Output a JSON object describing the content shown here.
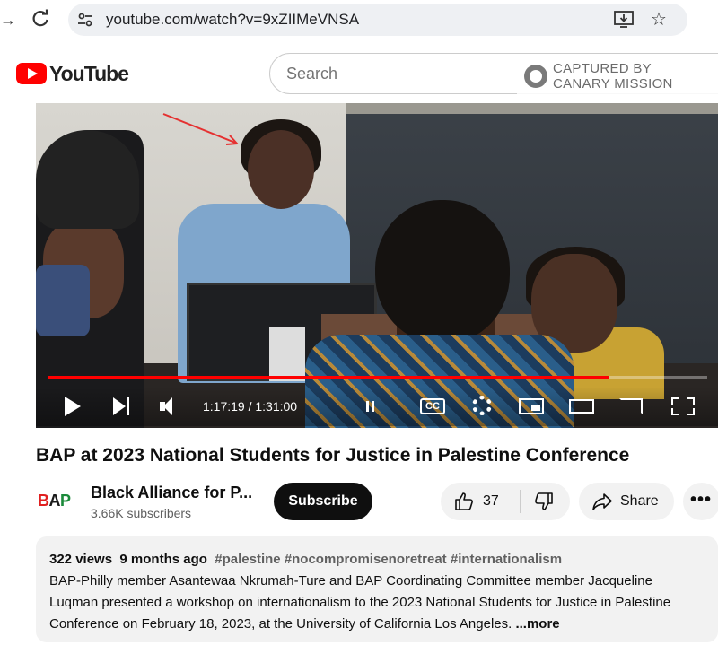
{
  "browser": {
    "url": "youtube.com/watch?v=9xZIIMeVNSA"
  },
  "header": {
    "logo_text": "YouTube",
    "search_placeholder": "Search",
    "watermark_line1": "CAPTURED BY",
    "watermark_line2": "CANARY MISSION"
  },
  "player": {
    "time_display": "1:17:19 / 1:31:00",
    "progress": 0.85,
    "cc_label": "CC"
  },
  "video": {
    "title": "BAP at 2023 National Students for Justice in Palestine Conference"
  },
  "channel": {
    "name": "Black Alliance for P...",
    "subscribers": "3.66K subscribers",
    "subscribe_label": "Subscribe"
  },
  "actions": {
    "like_count": "37",
    "share_label": "Share"
  },
  "description": {
    "views": "322 views",
    "age": "9 months ago",
    "hashtags": "#palestine #nocompromisenoretreat #internationalism",
    "text": "BAP-Philly member Asantewaa Nkrumah-Ture and BAP Coordinating Committee member Jacqueline Luqman presented a workshop on internationalism to the 2023 National Students for Justice in Palestine Conference on February 18, 2023, at the University of California Los Angeles.",
    "more_label": "...more"
  },
  "colors": {
    "accent_red": "#ff0000",
    "subscribe_bg": "#0f0f0f",
    "chip_bg": "#f2f2f2"
  }
}
